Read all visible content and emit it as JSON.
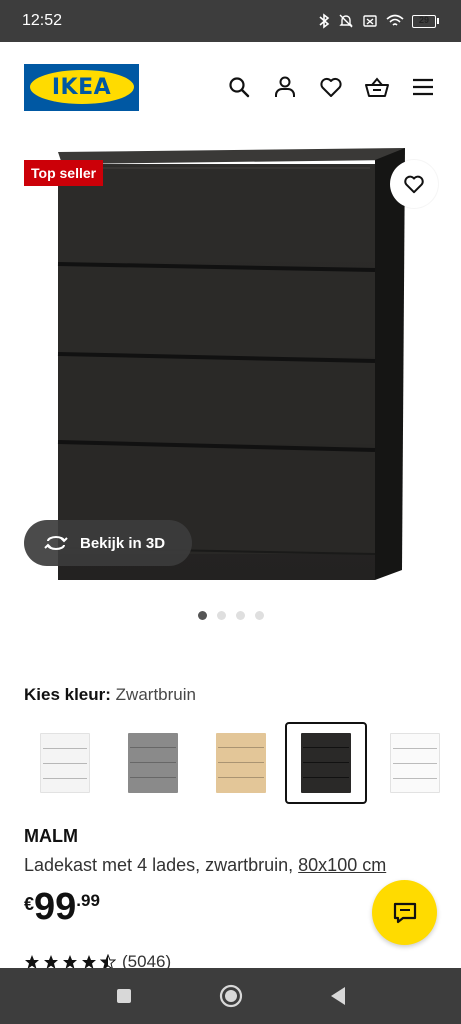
{
  "status": {
    "time": "12:52",
    "battery": "29"
  },
  "header": {
    "logo_text": "IKEA"
  },
  "product": {
    "badge": "Top seller",
    "view_3d_label": "Bekijk in 3D",
    "color_label": "Kies kleur:",
    "color_value": "Zwartbruin",
    "name": "MALM",
    "description": "Ladekast met 4 lades, zwartbruin,",
    "size": "80x100 cm",
    "price_currency": "€",
    "price_int": "99",
    "price_dec": ".99",
    "rating_count": "(5046)",
    "rating_value": 4.5
  },
  "swatches": [
    {
      "name": "white",
      "color": "#f4f4f4",
      "selected": false
    },
    {
      "name": "grey",
      "color": "#8a8a8a",
      "selected": false
    },
    {
      "name": "oak",
      "color": "#e3c698",
      "selected": false
    },
    {
      "name": "black-brown",
      "color": "#2a2928",
      "selected": true
    },
    {
      "name": "white-gloss",
      "color": "#fafafa",
      "selected": false
    }
  ],
  "gallery": {
    "count": 4,
    "active": 0
  },
  "colors": {
    "brand_blue": "#0058a3",
    "brand_yellow": "#ffdb00",
    "badge_red": "#cc0008"
  }
}
